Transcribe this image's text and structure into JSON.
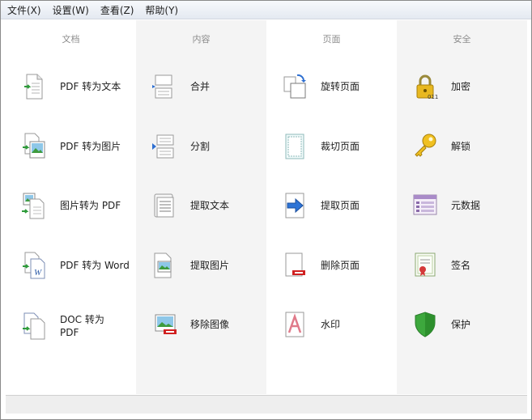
{
  "menu": [
    "文件(X)",
    "设置(W)",
    "查看(Z)",
    "帮助(Y)"
  ],
  "columns": [
    {
      "header": "文档",
      "tools": [
        {
          "label": "PDF 转为文本",
          "icon": "pdf-to-text-icon"
        },
        {
          "label": "PDF 转为图片",
          "icon": "pdf-to-image-icon"
        },
        {
          "label": "图片转为 PDF",
          "icon": "image-to-pdf-icon"
        },
        {
          "label": "PDF 转为 Word",
          "icon": "pdf-to-word-icon"
        },
        {
          "label": "DOC 转为 PDF",
          "icon": "doc-to-pdf-icon"
        }
      ]
    },
    {
      "header": "内容",
      "tools": [
        {
          "label": "合并",
          "icon": "merge-icon"
        },
        {
          "label": "分割",
          "icon": "split-icon"
        },
        {
          "label": "提取文本",
          "icon": "extract-text-icon"
        },
        {
          "label": "提取图片",
          "icon": "extract-image-icon"
        },
        {
          "label": "移除图像",
          "icon": "remove-image-icon"
        }
      ]
    },
    {
      "header": "页面",
      "tools": [
        {
          "label": "旋转页面",
          "icon": "rotate-page-icon"
        },
        {
          "label": "裁切页面",
          "icon": "crop-page-icon"
        },
        {
          "label": "提取页面",
          "icon": "extract-page-icon"
        },
        {
          "label": "删除页面",
          "icon": "delete-page-icon"
        },
        {
          "label": "水印",
          "icon": "watermark-icon"
        }
      ]
    },
    {
      "header": "安全",
      "tools": [
        {
          "label": "加密",
          "icon": "lock-icon"
        },
        {
          "label": "解锁",
          "icon": "key-icon"
        },
        {
          "label": "元数据",
          "icon": "metadata-icon"
        },
        {
          "label": "签名",
          "icon": "certificate-icon"
        },
        {
          "label": "保护",
          "icon": "shield-icon"
        }
      ]
    }
  ]
}
